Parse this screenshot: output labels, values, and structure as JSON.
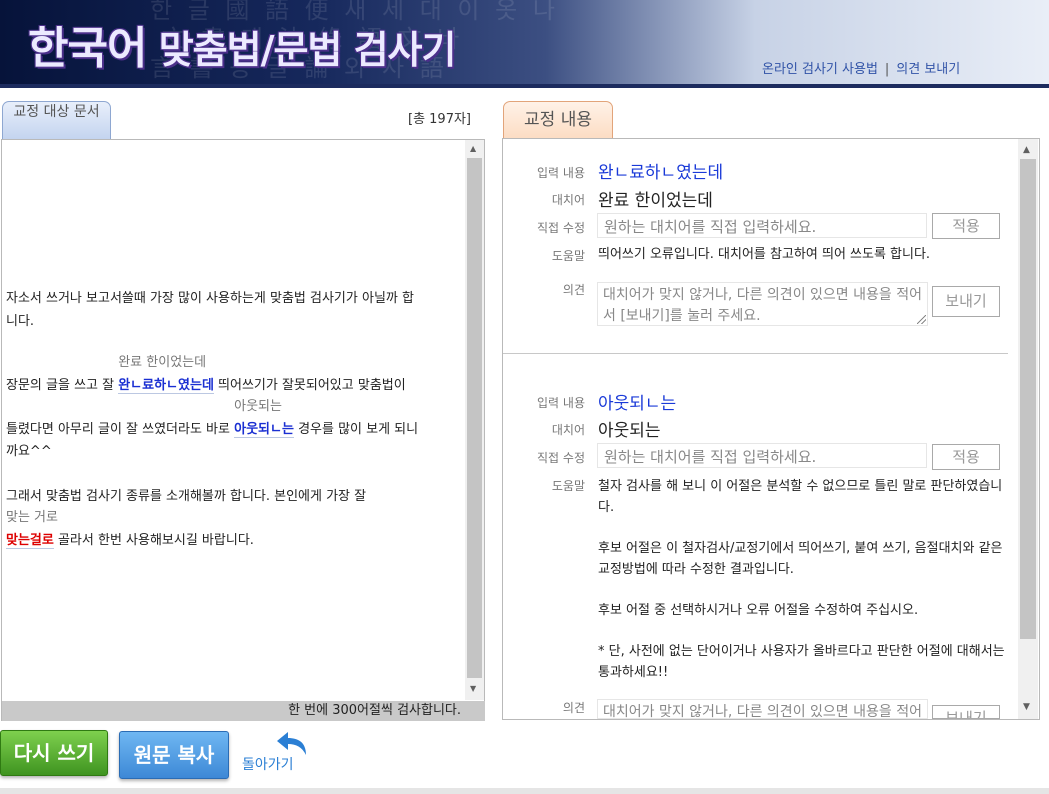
{
  "header": {
    "logo_part1": "한국어",
    "logo_part2": "맞춤법/문법 검사기",
    "bg_text": "한 글 國 語 便 새 세 대 이 옷 나\n 文 書 대 法 綠 語 文 바\n言 書 등 글 論 와 사 語\n 나 式 語 文 法 성",
    "link_usage": "온라인 검사기 사용법",
    "link_sep": "|",
    "link_feedback": "의견 보내기"
  },
  "left": {
    "tab_label": "교정 대상 문서",
    "char_count": "[총 197자]",
    "lines": {
      "l1": "자소서 쓰거나 보고서쓸때  가장 많이 사용하는게  맞춤법 검사기가 아닐까 합",
      "l2": "니다.",
      "l3_before": "장문의 글을 쓰고 잘 ",
      "l3_err": "완ㄴ료하ㄴ였는데",
      "l3_sug": "완료 한이었는데",
      "l3_after": " 띄어쓰기가 잘못되어있고 맞춤법이",
      "l4_before": "틀렸다면  아무리 글이 잘 쓰였더라도 바로 ",
      "l4_err": "아웃되ㄴ는",
      "l4_sug": "아웃되는",
      "l4_after": " 경우를 많이 보게 되니",
      "l5": "까요^^",
      "l6": "그래서 맞춤법 검사기 종류를 소개해볼까 합니다.  본인에게 가장 잘",
      "l7_err": "맞는걸로",
      "l7_sug": "맞는 거로",
      "l7_after": " 골라서 한번 사용해보시길 바랍니다."
    },
    "footer_note": "한 번에 300어절씩 검사합니다."
  },
  "buttons": {
    "rewrite": "다시 쓰기",
    "copy_original": "원문 복사",
    "back": "돌아가기"
  },
  "right": {
    "tab_label": "교정 내용",
    "labels": {
      "input": "입력 내용",
      "replacement": "대치어",
      "direct_edit": "직접 수정",
      "help": "도움말",
      "opinion": "의견"
    },
    "direct_placeholder": "원하는 대치어를 직접 입력하세요.",
    "apply_label": "적용",
    "opinion_placeholder": "대치어가 맞지 않거나, 다른 의견이 있으면 내용을 적어서 [보내기]를 눌러 주세요.",
    "send_label": "보내기",
    "items": [
      {
        "input": "완ㄴ료하ㄴ였는데",
        "replacement": "완료 한이었는데",
        "help": "띄어쓰기 오류입니다. 대치어를 참고하여 띄어 쓰도록 합니다."
      },
      {
        "input": "아웃되ㄴ는",
        "replacement": "아웃되는",
        "help_p1": "철자 검사를 해 보니 이 어절은 분석할 수 없으므로 틀린 말로 판단하였습니다.",
        "help_p2": "후보 어절은 이 철자검사/교정기에서 띄어쓰기, 붙여 쓰기, 음절대치와 같은 교정방법에 따라 수정한 결과입니다.",
        "help_p3": "후보 어절 중 선택하시거나 오류 어절을 수정하여 주십시오.",
        "help_p4": "* 단, 사전에 없는 단어이거나 사용자가 올바르다고 판단한 어절에 대해서는 통과하세요!!"
      }
    ]
  }
}
